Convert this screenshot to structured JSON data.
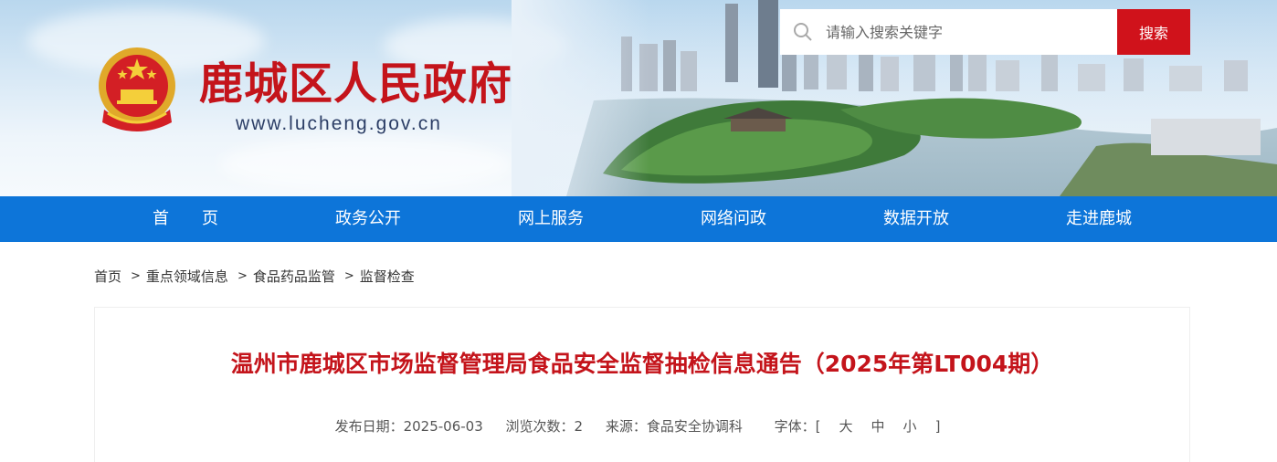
{
  "header": {
    "site_title": "鹿城区人民政府",
    "site_url": "www.lucheng.gov.cn",
    "emblem_icon": "national-emblem-icon",
    "search": {
      "placeholder": "请输入搜索关键字",
      "value": "",
      "button_label": "搜索",
      "icon": "search-icon"
    }
  },
  "nav": {
    "items": [
      {
        "label": "首　　页"
      },
      {
        "label": "政务公开"
      },
      {
        "label": "网上服务"
      },
      {
        "label": "网络问政"
      },
      {
        "label": "数据开放"
      },
      {
        "label": "走进鹿城"
      }
    ]
  },
  "breadcrumb": {
    "items": [
      "首页",
      "重点领域信息",
      "食品药品监管",
      "监督检查"
    ],
    "separator": ">"
  },
  "article": {
    "title": "温州市鹿城区市场监督管理局食品安全监督抽检信息通告（2025年第LT004期）",
    "publish_date_label": "发布日期：2025-06-03",
    "views_label": "浏览次数：2",
    "source_label": "来源：食品安全协调科",
    "font_label": "字体：[",
    "font_large": "大",
    "font_medium": "中",
    "font_small": "小",
    "font_close": "]"
  },
  "colors": {
    "brand_red": "#c4141b",
    "nav_blue": "#0d75d9",
    "search_button_red": "#d0121b"
  }
}
